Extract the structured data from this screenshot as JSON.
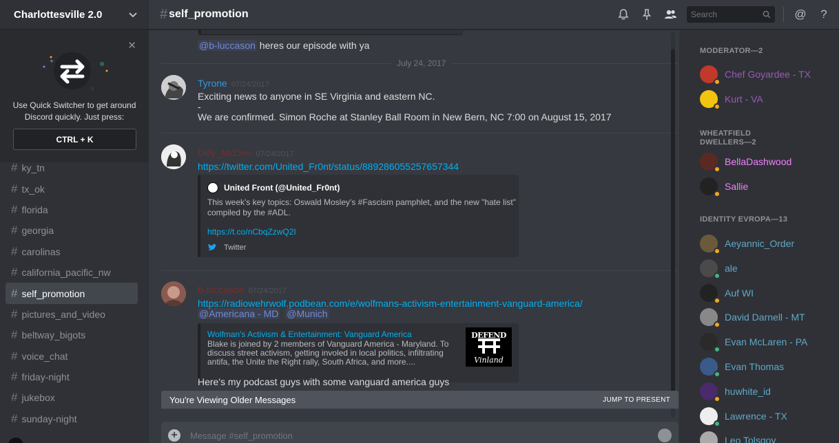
{
  "guild": {
    "name": "Charlottesville 2.0"
  },
  "quick_switcher": {
    "text": "Use Quick Switcher to get around Discord quickly. Just press:",
    "shortcut": "CTRL + K"
  },
  "channels": [
    {
      "name": "ky_tn",
      "active": false
    },
    {
      "name": "tx_ok",
      "active": false
    },
    {
      "name": "florida",
      "active": false
    },
    {
      "name": "georgia",
      "active": false
    },
    {
      "name": "carolinas",
      "active": false
    },
    {
      "name": "california_pacific_nw",
      "active": false
    },
    {
      "name": "self_promotion",
      "active": true
    },
    {
      "name": "pictures_and_video",
      "active": false
    },
    {
      "name": "beltway_bigots",
      "active": false
    },
    {
      "name": "voice_chat",
      "active": false
    },
    {
      "name": "friday-night",
      "active": false
    },
    {
      "name": "jukebox",
      "active": false
    },
    {
      "name": "sunday-night",
      "active": false
    }
  ],
  "topbar": {
    "channel": "self_promotion",
    "hash": "#",
    "search_placeholder": "Search",
    "at_label": "@",
    "help_label": "?"
  },
  "chat": {
    "prior_line": {
      "mention": "@b-luccason",
      "text": " heres our episode with ya"
    },
    "date_divider": "July 24, 2017",
    "messages": [
      {
        "author": "Tyrone",
        "author_color": "#3498db",
        "timestamp": "07/24/2017",
        "lines": [
          "Exciting news to anyone in SE Virginia and eastern NC.",
          "-",
          "We are confirmed. Simon Roche at Stanley Ball Room in New Bern, NC 7:00 on August 15, 2017"
        ]
      },
      {
        "author": "Dilly_McDee",
        "author_color": "#71302f",
        "timestamp": "07/24/2017",
        "link": "https://twitter.com/United_Fr0nt/status/889286055257657344",
        "embed": {
          "author": "United Front (@United_Fr0nt)",
          "description": "This week's key topics: Oswald Mosley's #Fascism pamphlet, and the new \"hate list\" compiled by the #ADL.",
          "link": "https://t.co/nCbqZzwQ2I",
          "footer": "Twitter"
        }
      },
      {
        "author": "b-luccason",
        "author_color": "#71302f",
        "timestamp": "07/24/2017",
        "link": "https://radiowehrwolf.podbean.com/e/wolfmans-activism-entertainment-vanguard-america/",
        "mentions": [
          "@Americana - MD",
          "@Munich"
        ],
        "embed": {
          "title": "Wolfman's Activism & Entertainment: Vanguard America",
          "description": "Blake is joined by 2 members of Vanguard America - Maryland. To discuss street activism, getting involed in local politics, infiltrating antifa, the Unite the Right rally, South Africa, and more....",
          "thumb_top": "DEFEND",
          "thumb_bottom": "Vinland"
        },
        "trailing": "Here's my podcast guys with some vanguard america guys"
      }
    ],
    "older_bar": {
      "text": "You're Viewing Older Messages",
      "jump": "JUMP TO PRESENT"
    },
    "composer_placeholder": "Message #self_promotion"
  },
  "members": {
    "groups": [
      {
        "title": "MODERATOR—2",
        "members": [
          {
            "name": "Chef Goyardee - TX",
            "color": "#9b59b6",
            "status": "#faa61a"
          },
          {
            "name": "Kurt - VA",
            "color": "#9b59b6",
            "status": "#faa61a"
          }
        ]
      },
      {
        "title": "WHEATFIELD DWELLERS—2",
        "members": [
          {
            "name": "BellaDashwood",
            "color": "#f47fff",
            "status": "#faa61a"
          },
          {
            "name": "Sallie",
            "color": "#f47fff",
            "status": "#faa61a"
          }
        ]
      },
      {
        "title": "IDENTITY EVROPA—13",
        "members": [
          {
            "name": "Aeyannic_Order",
            "color": "#60a8c8",
            "status": "#faa61a"
          },
          {
            "name": "ale",
            "color": "#60a8c8",
            "status": "#43b581"
          },
          {
            "name": "Auf WI",
            "color": "#60a8c8",
            "status": "#faa61a"
          },
          {
            "name": "David Darnell - MT",
            "color": "#60a8c8",
            "status": "#faa61a"
          },
          {
            "name": "Evan McLaren - PA",
            "color": "#60a8c8",
            "status": "#43b581"
          },
          {
            "name": "Evan Thomas",
            "color": "#60a8c8",
            "status": "#43b581"
          },
          {
            "name": "huwhite_id",
            "color": "#60a8c8",
            "status": "#faa61a"
          },
          {
            "name": "Lawrence - TX",
            "color": "#60a8c8",
            "status": "#43b581"
          },
          {
            "name": "Leo Tolsgoy",
            "color": "#60a8c8",
            "status": "#43b581"
          }
        ]
      }
    ]
  }
}
